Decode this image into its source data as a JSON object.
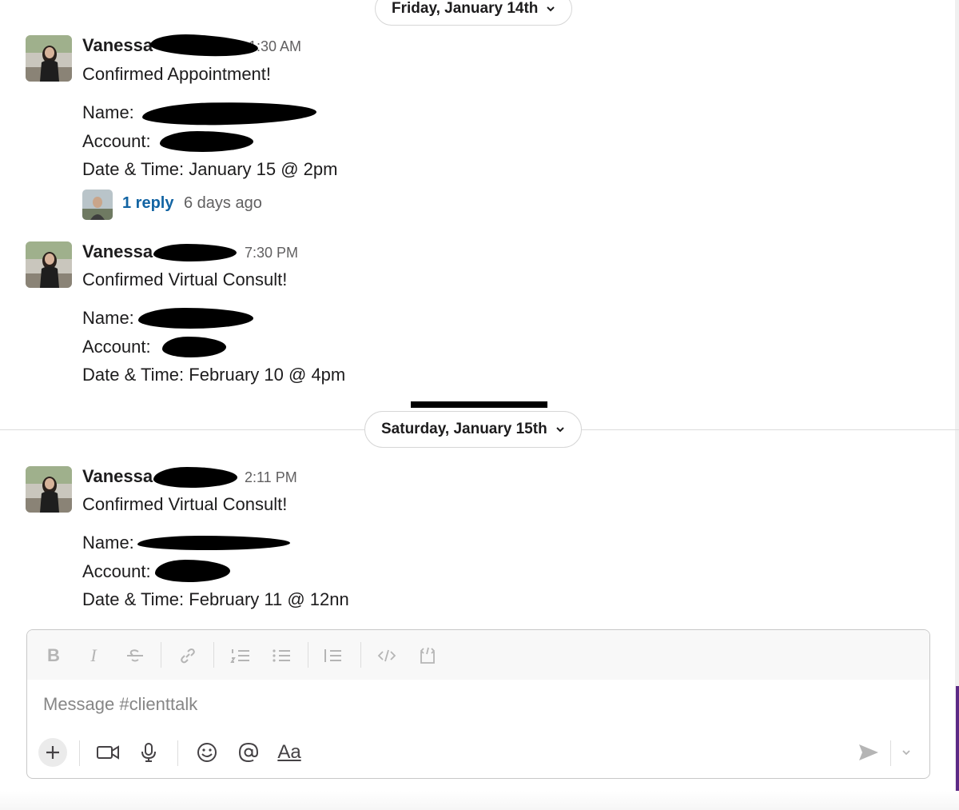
{
  "date_dividers": [
    {
      "label": "Friday, January 14th"
    },
    {
      "label": "Saturday, January 15th"
    }
  ],
  "messages": [
    {
      "sender": "Vanessa",
      "time": ":1:30 AM",
      "title": "Confirmed Appointment!",
      "name_label": "Name:",
      "account_label": "Account:",
      "datetime_label": "Date & Time: January 15 @ 2pm",
      "thread": {
        "reply_count": "1 reply",
        "last_reply": "6 days ago"
      }
    },
    {
      "sender": "Vanessa",
      "time": "7:30 PM",
      "title": "Confirmed Virtual Consult!",
      "name_label": "Name:",
      "account_label": "Account:",
      "datetime_label": "Date & Time: February 10 @ 4pm"
    },
    {
      "sender": "Vanessa",
      "time": "2:11 PM",
      "title": "Confirmed Virtual Consult!",
      "name_label": "Name:",
      "account_label": "Account:",
      "datetime_label": "Date & Time: February 11 @ 12nn"
    }
  ],
  "composer": {
    "placeholder": "Message #clienttalk",
    "formatting_icons": [
      "bold-icon",
      "italic-icon",
      "strikethrough-icon",
      "link-icon",
      "ordered-list-icon",
      "bulleted-list-icon",
      "blockquote-icon",
      "code-icon",
      "code-block-icon"
    ],
    "action_icons": [
      "plus-icon",
      "video-icon",
      "microphone-icon",
      "emoji-icon",
      "mention-icon",
      "text-format-icon",
      "send-icon",
      "chevron-down-icon"
    ],
    "bold_glyph": "B",
    "italic_glyph": "I",
    "format_glyph": "Aa"
  },
  "colors": {
    "link": "#1264a3",
    "muted": "#616061",
    "accent_edge": "#5b2a86"
  }
}
